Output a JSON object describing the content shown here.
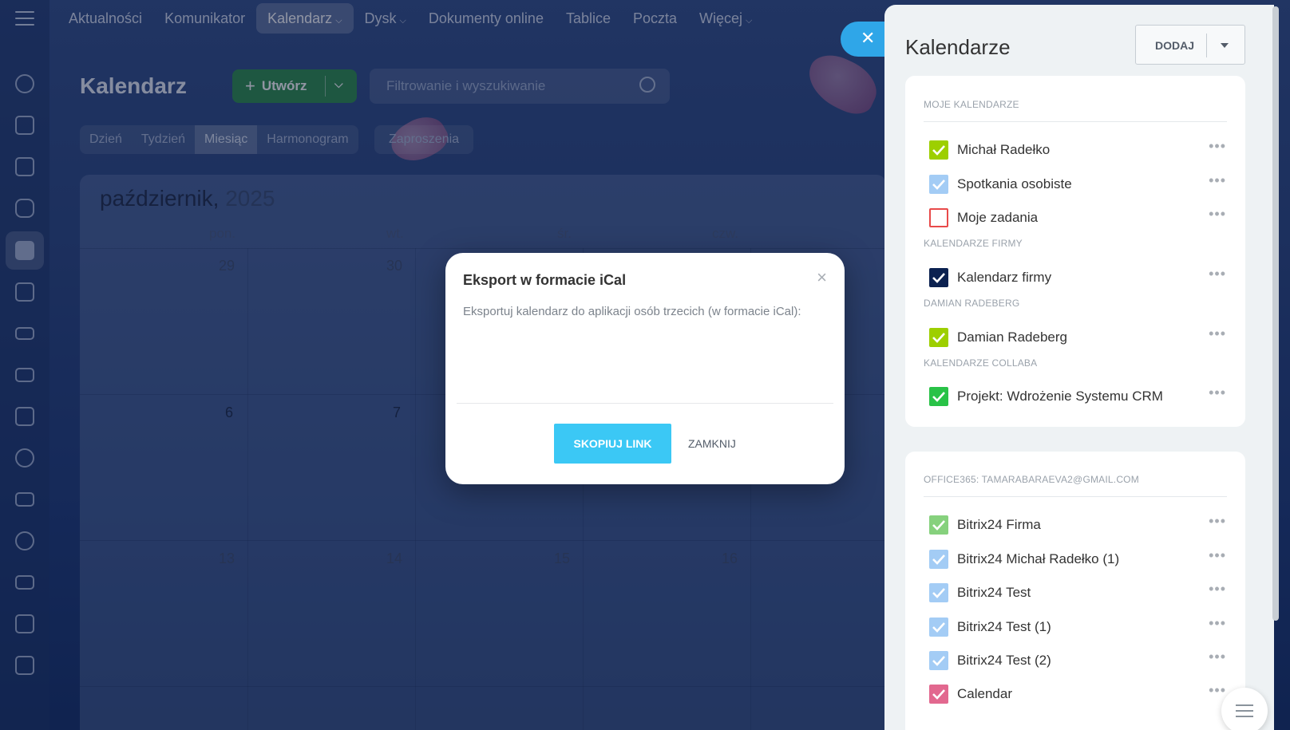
{
  "nav": {
    "items": [
      {
        "label": "Aktualności",
        "dropdown": false,
        "active": false
      },
      {
        "label": "Komunikator",
        "dropdown": false,
        "active": false
      },
      {
        "label": "Kalendarz",
        "dropdown": true,
        "active": true
      },
      {
        "label": "Dysk",
        "dropdown": true,
        "active": false
      },
      {
        "label": "Dokumenty online",
        "dropdown": false,
        "active": false
      },
      {
        "label": "Tablice",
        "dropdown": false,
        "active": false
      },
      {
        "label": "Poczta",
        "dropdown": false,
        "active": false
      },
      {
        "label": "Więcej",
        "dropdown": true,
        "active": false
      }
    ]
  },
  "page": {
    "title": "Kalendarz",
    "create_label": "Utwórz",
    "search_placeholder": "Filtrowanie i wyszukiwanie",
    "views": [
      "Dzień",
      "Tydzień",
      "Miesiąc",
      "Harmonogram"
    ],
    "active_view": "Miesiąc",
    "invites_label": "Zaproszenia"
  },
  "calendar": {
    "month": "październik,",
    "year": "2025",
    "weekdays": [
      "pon.",
      "wt.",
      "śr.",
      "czw."
    ],
    "weeks": [
      [
        "29",
        "30",
        "",
        ""
      ],
      [
        "6",
        "7",
        "",
        ""
      ],
      [
        "13",
        "14",
        "15",
        "16"
      ]
    ]
  },
  "modal": {
    "title": "Eksport w formacie iCal",
    "text": "Eksportuj kalendarz do aplikacji osób trzecich (w formacie iCal):",
    "copy_label": "SKOPIUJ LINK",
    "close_label": "ZAMKNIJ"
  },
  "panel": {
    "title": "Kalendarze",
    "add_label": "DODAJ",
    "sections": [
      {
        "label": "MOJE KALENDARZE",
        "items": [
          {
            "name": "Michał Radełko",
            "color": "#9dcf00",
            "checked": true
          },
          {
            "name": "Spotkania osobiste",
            "color": "#a3ccf5",
            "checked": true
          },
          {
            "name": "Moje zadania",
            "color": "#e84a4a",
            "checked": false
          }
        ]
      },
      {
        "label": "KALENDARZE FIRMY",
        "items": [
          {
            "name": "Kalendarz firmy",
            "color": "#0b2150",
            "checked": true
          }
        ]
      },
      {
        "label": "DAMIAN RADEBERG",
        "items": [
          {
            "name": "Damian Radeberg",
            "color": "#9dcf00",
            "checked": true
          }
        ]
      },
      {
        "label": "KALENDARZE COLLABA",
        "items": [
          {
            "name": "Projekt: Wdrożenie Systemu CRM",
            "color": "#29c247",
            "checked": true
          }
        ]
      }
    ],
    "external": {
      "label": "OFFICE365: TAMARABARAEVA2@GMAIL.COM",
      "items": [
        {
          "name": "Bitrix24 Firma",
          "color": "#86d17d",
          "checked": true
        },
        {
          "name": "Bitrix24 Michał Radełko (1)",
          "color": "#a3ccf5",
          "checked": true
        },
        {
          "name": "Bitrix24 Test",
          "color": "#a3ccf5",
          "checked": true
        },
        {
          "name": "Bitrix24 Test (1)",
          "color": "#a3ccf5",
          "checked": true
        },
        {
          "name": "Bitrix24 Test (2)",
          "color": "#a3ccf5",
          "checked": true
        },
        {
          "name": "Calendar",
          "color": "#e2688f",
          "checked": true
        }
      ]
    }
  }
}
